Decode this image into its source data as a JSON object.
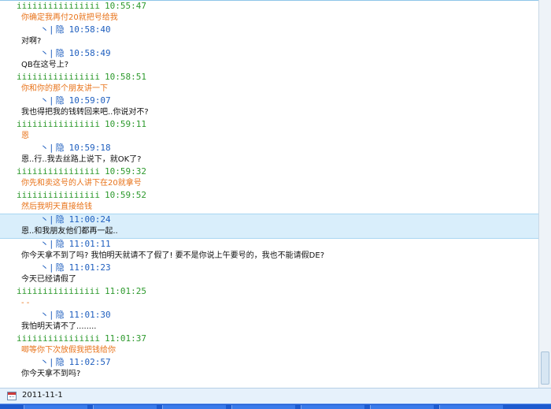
{
  "chat": {
    "messages": [
      {
        "sender": "friend",
        "nick": "iiiiiiiiiiiiiiii",
        "time": "10:55:47",
        "text": "你确定我再付20就把号给我"
      },
      {
        "sender": "self",
        "mark": "丶|",
        "nick": "隐",
        "time": "10:58:40",
        "text": "对啊?"
      },
      {
        "sender": "self",
        "mark": "丶|",
        "nick": "隐",
        "time": "10:58:49",
        "text": "QB在这号上?"
      },
      {
        "sender": "friend",
        "nick": "iiiiiiiiiiiiiiii",
        "time": "10:58:51",
        "text": "你和你的那个朋友讲一下"
      },
      {
        "sender": "self",
        "mark": "丶|",
        "nick": "隐",
        "time": "10:59:07",
        "text": "我也得把我的钱转回来吧..你说对不?"
      },
      {
        "sender": "friend",
        "nick": "iiiiiiiiiiiiiiii",
        "time": "10:59:11",
        "text": "恩"
      },
      {
        "sender": "self",
        "mark": "丶|",
        "nick": "隐",
        "time": "10:59:18",
        "text": "恩..行..我去丝路上说下，就OK了?"
      },
      {
        "sender": "friend",
        "nick": "iiiiiiiiiiiiiiii",
        "time": "10:59:32",
        "text": "你先和卖这号的人讲下在20就拿号"
      },
      {
        "sender": "friend",
        "nick": "iiiiiiiiiiiiiiii",
        "time": "10:59:52",
        "text": "然后我明天直接给钱"
      },
      {
        "sender": "self",
        "mark": "丶|",
        "nick": "隐",
        "time": "11:00:24",
        "text": "恩..和我朋友他们都再一起..",
        "selected": true
      },
      {
        "sender": "self",
        "mark": "丶|",
        "nick": "隐",
        "time": "11:01:11",
        "text": "你今天拿不到了吗?     我怕明天就请不了假了!     要不是你说上午要号的，我也不能请假DE?"
      },
      {
        "sender": "self",
        "mark": "丶|",
        "nick": "隐",
        "time": "11:01:23",
        "text": "今天已经请假了"
      },
      {
        "sender": "friend",
        "nick": "iiiiiiiiiiiiiiii",
        "time": "11:01:25",
        "text": "- -"
      },
      {
        "sender": "self",
        "mark": "丶|",
        "nick": "隐",
        "time": "11:01:30",
        "text": "我怕明天请不了........"
      },
      {
        "sender": "friend",
        "nick": "iiiiiiiiiiiiiiii",
        "time": "11:01:37",
        "text": "唧等你下次放假我把钱给你"
      },
      {
        "sender": "self",
        "mark": "丶|",
        "nick": "隐",
        "time": "11:02:57",
        "text": "你今天拿不到吗?"
      }
    ]
  },
  "footer": {
    "date": "2011-11-1"
  },
  "colors": {
    "friend_header": "#2e9a2e",
    "friend_text": "#e8731a",
    "self_header": "#1f5fbf",
    "self_text": "#111111",
    "selected_row": "#d9eefb",
    "taskbar": "#1e5bcf"
  }
}
